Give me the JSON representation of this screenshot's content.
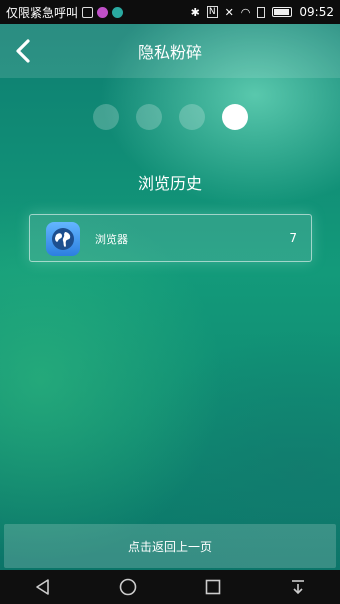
{
  "statusbar": {
    "carrier_text": "仅限紧急呼叫",
    "time": "09:52",
    "icons_left": [
      "image-icon",
      "message-icon",
      "app-icon"
    ],
    "icons_right": [
      "bluetooth-icon",
      "nfc-icon",
      "silent-icon",
      "wifi-icon",
      "sim-icon",
      "battery-icon"
    ]
  },
  "header": {
    "title": "隐私粉碎",
    "back_icon": "chevron-left-icon"
  },
  "steps": {
    "total": 4,
    "current": 4
  },
  "section": {
    "title": "浏览历史"
  },
  "items": [
    {
      "label": "浏览器",
      "count": "7",
      "icon": "globe-icon"
    }
  ],
  "footer": {
    "button_label": "点击返回上一页"
  },
  "navbar": {
    "buttons": [
      "back-icon",
      "home-icon",
      "recents-icon",
      "notifications-icon"
    ]
  },
  "colors": {
    "background": "#0f7a6a",
    "accent": "#ffffff",
    "icon_blue": "#2c7fe0"
  }
}
